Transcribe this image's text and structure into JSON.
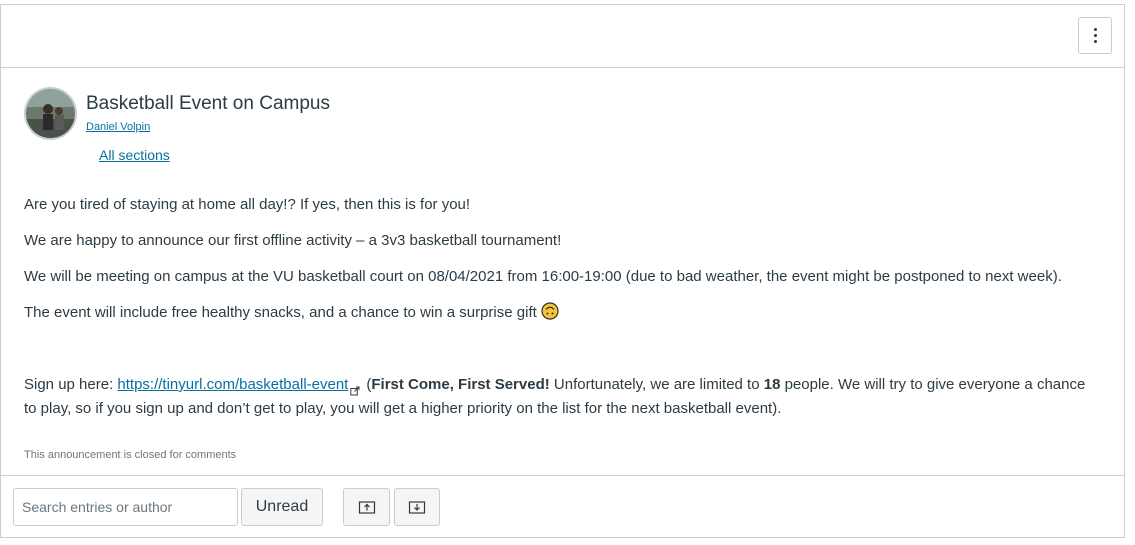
{
  "post": {
    "title": "Basketball Event on Campus",
    "author": "Daniel Volpin",
    "sections": "All sections",
    "paragraphs": [
      "Are you tired of staying at home all day!? If yes, then this is for you!",
      "We are happy to announce our first offline activity – a 3v3 basketball tournament!",
      "We will be meeting on campus at the VU basketball court on 08/04/2021 from 16:00-19:00 (due to bad weather, the event might be postponed to next week).",
      "The event will include free healthy snacks, and a chance to win a surprise gift"
    ],
    "signup": {
      "prefix": "Sign up here: ",
      "link_text": "https://tinyurl.com/basketball-event",
      "bold1": "First Come, First Served!",
      "mid": " Unfortunately, we are limited to ",
      "bold2": "18",
      "rest": " people. We will try to give everyone a chance to play, so if you sign up and don’t get to play, you will get a higher priority on the list for the next basketball event)."
    },
    "closed_note": "This announcement is closed for comments"
  },
  "toolbar": {
    "search_placeholder": "Search entries or author",
    "unread_label": "Unread"
  },
  "icons": {
    "options": "kebab-menu-icon",
    "external_link": "external-link-icon",
    "emoji": "upside-down-face-emoji",
    "expand": "expand-threads-icon",
    "collapse": "collapse-threads-icon"
  },
  "colors": {
    "link": "#0770a3",
    "text": "#2d3b45",
    "border": "#c7cdd1",
    "emoji": "#f7c43a"
  }
}
